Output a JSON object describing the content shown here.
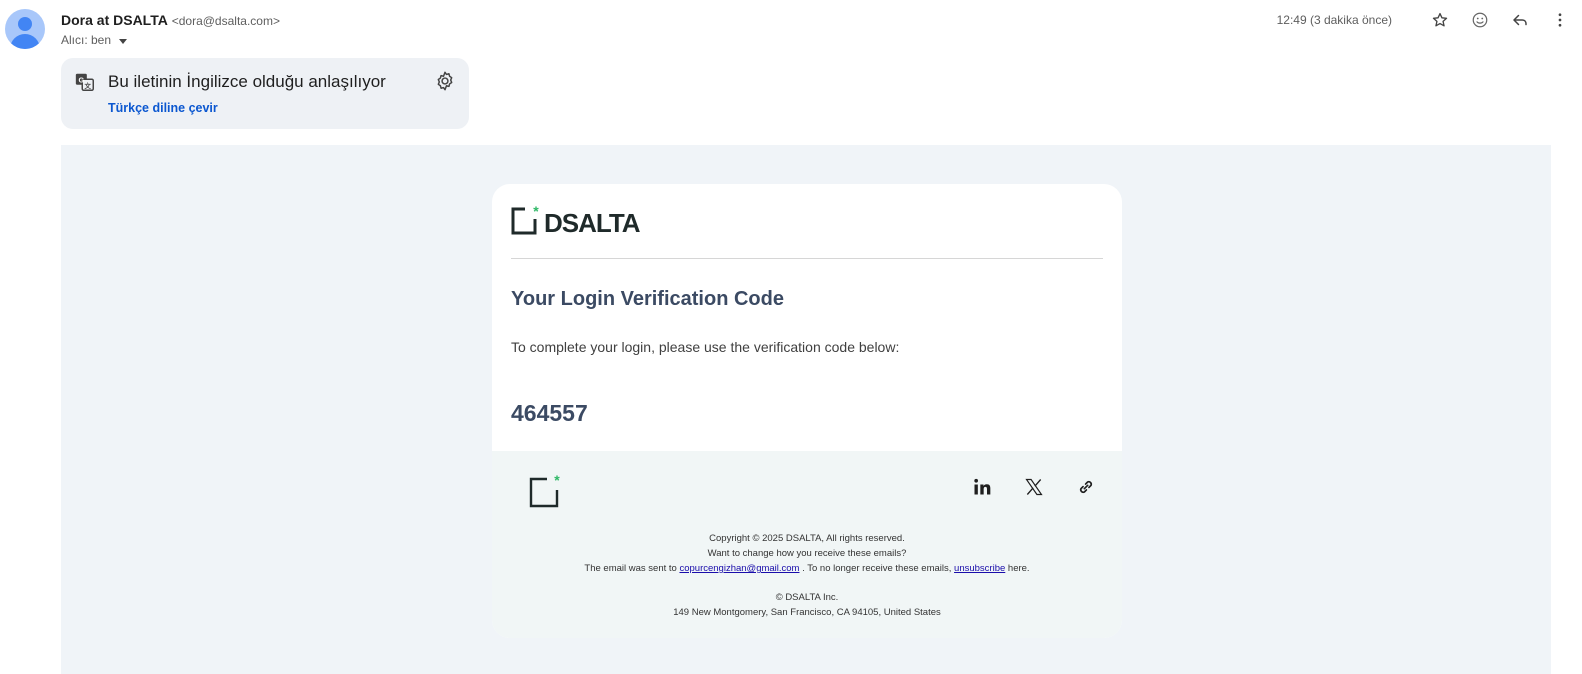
{
  "header": {
    "sender_name": "Dora at DSALTA",
    "sender_email": "<dora@dsalta.com>",
    "recipient": "Alıcı: ben",
    "time": "12:49 (3 dakika önce)",
    "icons": [
      "star-icon",
      "emoji-icon",
      "reply-icon",
      "more-vert-icon"
    ]
  },
  "translate": {
    "title": "Bu iletinin İngilizce olduğu anlaşılıyor",
    "action": "Türkçe diline çevir",
    "link_color": "#0b57d0"
  },
  "email": {
    "logo_text": "DSALTA",
    "heading": "Your Login Verification Code",
    "intro": "To complete your login, please use the verification code below:",
    "code": "464557",
    "accent_color": "#2fb866",
    "footer": {
      "social": [
        "linkedin-icon",
        "x-icon",
        "link-icon"
      ],
      "copyright": "Copyright © 2025 DSALTA, All rights reserved.",
      "change_prefs": "Want to change how you receive these emails?",
      "sent_prefix": "The email was sent to",
      "sent_email": "copurcengizhan@gmail.com",
      "sent_mid": ". To no longer receive these emails,",
      "unsubscribe": "unsubscribe",
      "sent_suffix": "here.",
      "company": "© DSALTA Inc.",
      "address": "149 New Montgomery, San Francisco, CA 94105, United States"
    }
  }
}
